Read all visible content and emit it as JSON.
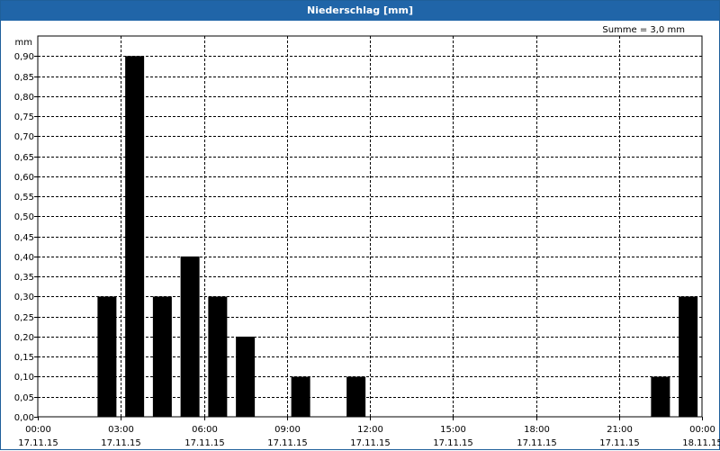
{
  "window": {
    "title": "Niederschlag [mm]"
  },
  "summary_text": "Summe = 3,0 mm",
  "chart_data": {
    "type": "bar",
    "title": "Niederschlag [mm]",
    "ylabel": "mm",
    "ylim": [
      0,
      0.95
    ],
    "y_ticks": [
      "0,00",
      "0,05",
      "0,10",
      "0,15",
      "0,20",
      "0,25",
      "0,30",
      "0,35",
      "0,40",
      "0,45",
      "0,50",
      "0,55",
      "0,60",
      "0,65",
      "0,70",
      "0,75",
      "0,80",
      "0,85",
      "0,90"
    ],
    "x_ticks": [
      {
        "time": "00:00",
        "date": "17.11.15"
      },
      {
        "time": "03:00",
        "date": "17.11.15"
      },
      {
        "time": "06:00",
        "date": "17.11.15"
      },
      {
        "time": "09:00",
        "date": "17.11.15"
      },
      {
        "time": "12:00",
        "date": "17.11.15"
      },
      {
        "time": "15:00",
        "date": "17.11.15"
      },
      {
        "time": "18:00",
        "date": "17.11.15"
      },
      {
        "time": "21:00",
        "date": "17.11.15"
      },
      {
        "time": "00:00",
        "date": "18.11.15"
      }
    ],
    "grid": true,
    "bar_color": "#000000",
    "series": [
      {
        "x": [
          "03:00",
          "04:00",
          "05:00",
          "06:00",
          "07:00",
          "08:00",
          "10:00",
          "12:00",
          "23:00",
          "00:00 (18.11.15)"
        ],
        "values": [
          0.3,
          0.9,
          0.3,
          0.4,
          0.3,
          0.2,
          0.1,
          0.1,
          0.1,
          0.3
        ]
      }
    ]
  }
}
